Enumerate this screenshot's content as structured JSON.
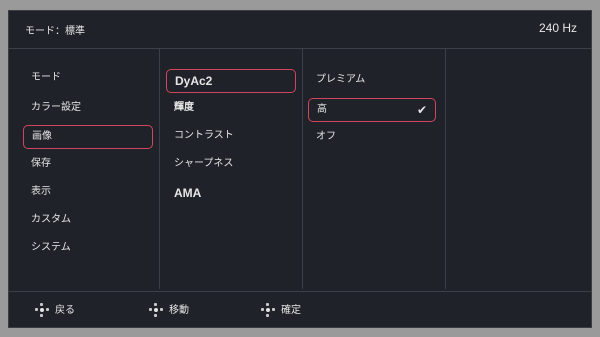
{
  "header": {
    "mode_label": "モード：標準",
    "refresh_rate": "240 Hz"
  },
  "menu_col1": [
    {
      "label": "モード"
    },
    {
      "label": "カラー設定"
    },
    {
      "label": "画像"
    },
    {
      "label": "保存"
    },
    {
      "label": "表示"
    },
    {
      "label": "カスタム"
    },
    {
      "label": "システム"
    }
  ],
  "menu_col2": [
    {
      "label": "DyAc2"
    },
    {
      "label": "輝度"
    },
    {
      "label": "コントラスト"
    },
    {
      "label": "シャープネス"
    },
    {
      "label": "AMA"
    }
  ],
  "menu_col3": [
    {
      "label": "プレミアム"
    },
    {
      "label": "高"
    },
    {
      "label": "オフ"
    }
  ],
  "footer": {
    "back": "戻る",
    "move": "移動",
    "confirm": "確定"
  },
  "selection": {
    "col1": "画像",
    "col2": "DyAc2",
    "col3": "高",
    "accent": "#d0465a",
    "checked_icon": "check-icon"
  }
}
